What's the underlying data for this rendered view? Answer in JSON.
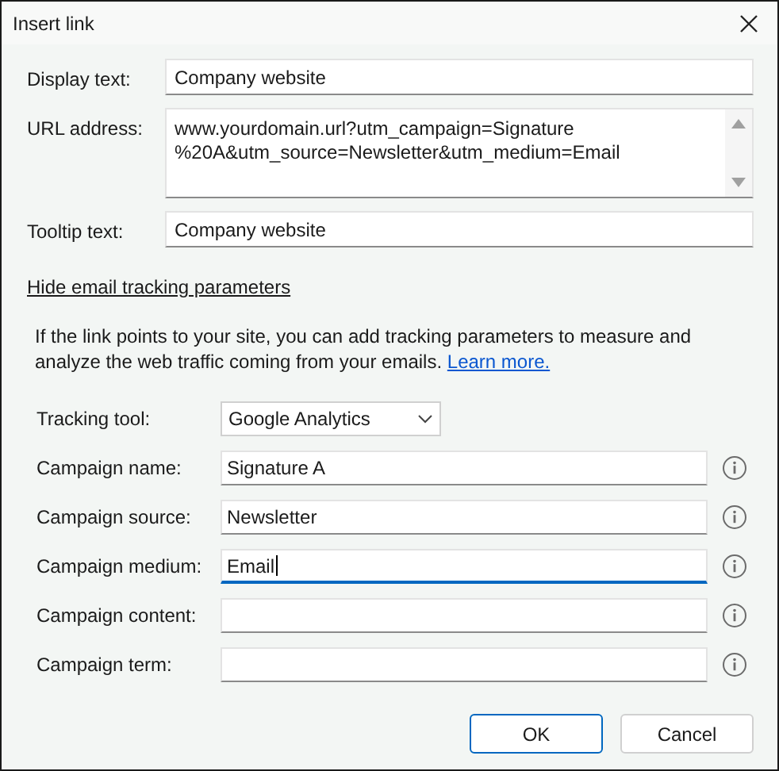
{
  "window": {
    "title": "Insert link"
  },
  "link_fields": [
    {
      "kind": "line",
      "label": "Display text:",
      "value": "Company website"
    },
    {
      "kind": "multiline",
      "label": "URL address:",
      "value": "www.yourdomain.url?utm_campaign=Signature %20A&utm_source=Newsletter&utm_medium=Email"
    },
    {
      "kind": "line",
      "label": "Tooltip text:",
      "value": "Company website"
    }
  ],
  "toggle_link": "Hide email tracking parameters",
  "description": {
    "text": "If the link points to your site, you can add tracking parameters to measure and analyze the web traffic coming from your emails.",
    "link": "Learn more."
  },
  "tracking_tool": {
    "label": "Tracking tool:",
    "value": "Google Analytics"
  },
  "campaign_fields": [
    {
      "label": "Campaign name:",
      "value": "Signature A",
      "focused": false
    },
    {
      "label": "Campaign source:",
      "value": "Newsletter",
      "focused": false
    },
    {
      "label": "Campaign medium:",
      "value": "Email",
      "focused": true
    },
    {
      "label": "Campaign content:",
      "focused": false
    },
    {
      "label": "Campaign term:",
      "focused": false
    }
  ],
  "buttons": [
    {
      "label": "OK",
      "default": true
    },
    {
      "label": "Cancel",
      "default": false
    }
  ]
}
